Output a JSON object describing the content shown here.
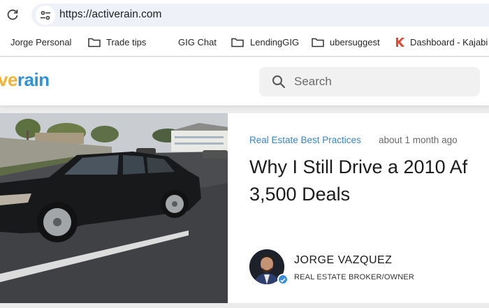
{
  "browser": {
    "url": "https://activerain.com"
  },
  "bookmarks": [
    {
      "label": "Jorge Personal",
      "icon": "folder-icon"
    },
    {
      "label": "Trade tips",
      "icon": "folder-icon"
    },
    {
      "label": "GIG Chat",
      "icon": "none"
    },
    {
      "label": "LendingGIG",
      "icon": "folder-icon"
    },
    {
      "label": "ubersuggest",
      "icon": "folder-icon"
    },
    {
      "label": "Dashboard - Kajabi",
      "icon": "kajabi-icon"
    }
  ],
  "site": {
    "logo_part1": "ve",
    "logo_part2": "rain",
    "logo_colors": {
      "part1": "#f2b233",
      "part2": "#2f92d8"
    },
    "search_placeholder": "Search"
  },
  "post": {
    "category": "Real Estate Best Practices",
    "time_ago": "about 1 month ago",
    "title_line1": "Why I Still Drive a 2010 Af",
    "title_line2": "3,500 Deals",
    "author_name": "JORGE VAZQUEZ",
    "author_role": "REAL ESTATE BROKER/OWNER"
  }
}
